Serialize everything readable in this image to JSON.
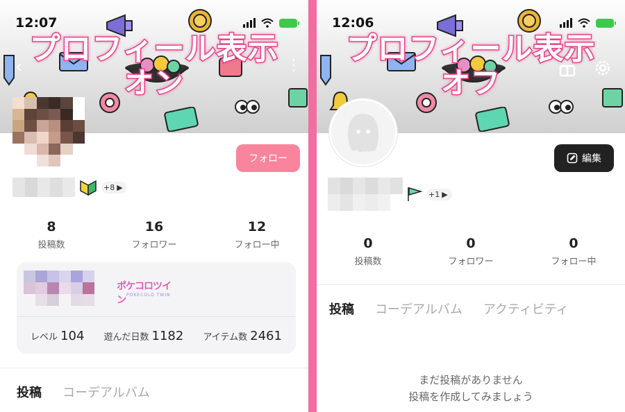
{
  "colors": {
    "accent_pink": "#f06fa0",
    "follow_pink": "#f8859c",
    "dark_button": "#222222"
  },
  "left": {
    "status_time": "12:07",
    "overlay_line1": "プロフィール表示",
    "overlay_line2": "オン",
    "follow_button": "フォロー",
    "badge_count": "+8",
    "stats": [
      {
        "value": "8",
        "label": "投稿数"
      },
      {
        "value": "16",
        "label": "フォロワー"
      },
      {
        "value": "12",
        "label": "フォロー中"
      }
    ],
    "game": {
      "logo_name": "ポケコロツイン",
      "logo_sub": "POKECOLO TWIN",
      "level_label": "レベル",
      "level_value": "104",
      "days_label": "遊んだ日数",
      "days_value": "1182",
      "items_label": "アイテム数",
      "items_value": "2461"
    },
    "tabs": [
      "投稿",
      "コーデアルバム"
    ]
  },
  "right": {
    "status_time": "12:06",
    "overlay_line1": "プロフィール表示",
    "overlay_line2": "オフ",
    "edit_button": "編集",
    "badge_count": "+1",
    "stats": [
      {
        "value": "0",
        "label": "投稿数"
      },
      {
        "value": "0",
        "label": "フォロワー"
      },
      {
        "value": "0",
        "label": "フォロー中"
      }
    ],
    "tabs": [
      "投稿",
      "コーデアルバム",
      "アクティビティ"
    ],
    "empty_line1": "まだ投稿がありません",
    "empty_line2": "投稿を作成してみましょう"
  },
  "icons": [
    "back-icon",
    "more-icon",
    "gift-icon",
    "gear-icon",
    "edit-icon",
    "wifi-icon",
    "battery-icon",
    "signal-icon"
  ]
}
